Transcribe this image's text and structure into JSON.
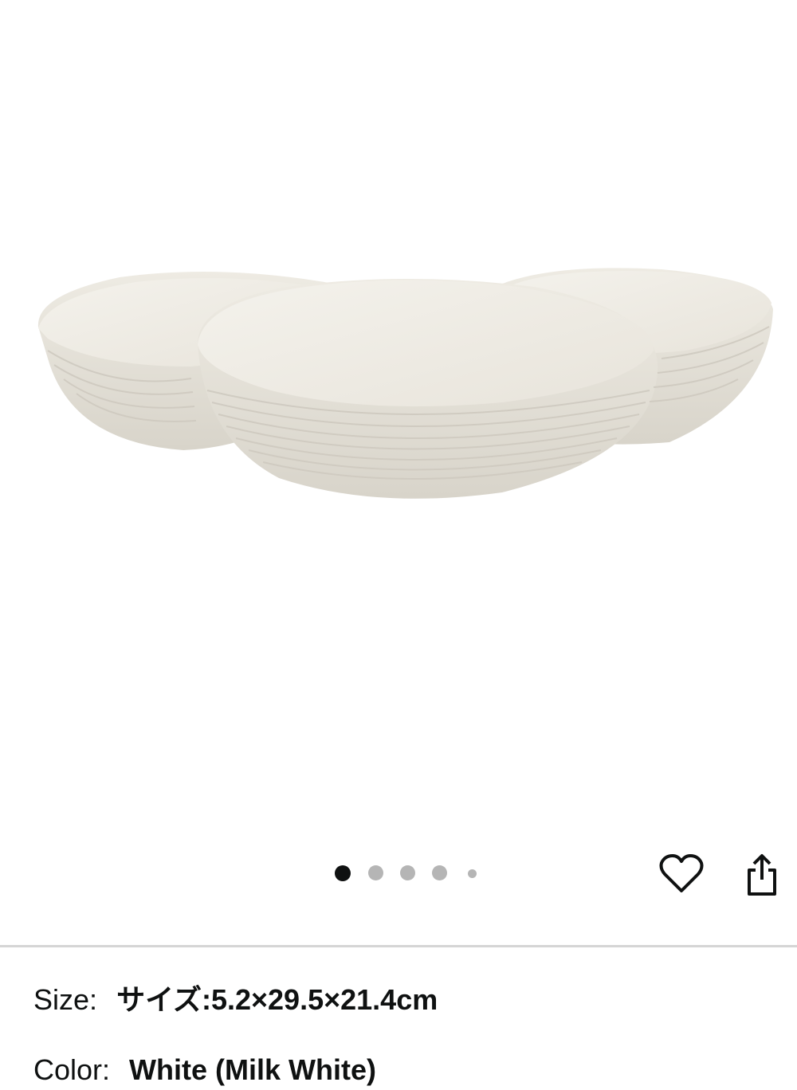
{
  "image_carousel": {
    "image_alt": "Three-compartment ridged serving bowl",
    "dot_count": 5,
    "active_index": 0
  },
  "actions": {
    "wishlist_icon": "heart-outline-icon",
    "share_icon": "share-icon"
  },
  "variation": {
    "size_label": "Size:",
    "size_value": "サイズ:5.2×29.5×21.4cm",
    "color_label": "Color:",
    "color_value": "White (Milk White)"
  },
  "colors": {
    "bowl": "#efece4",
    "bowl_shadow": "#d9d5cb",
    "dot_active": "#0f1111",
    "dot_inactive": "#b5b5b5"
  }
}
